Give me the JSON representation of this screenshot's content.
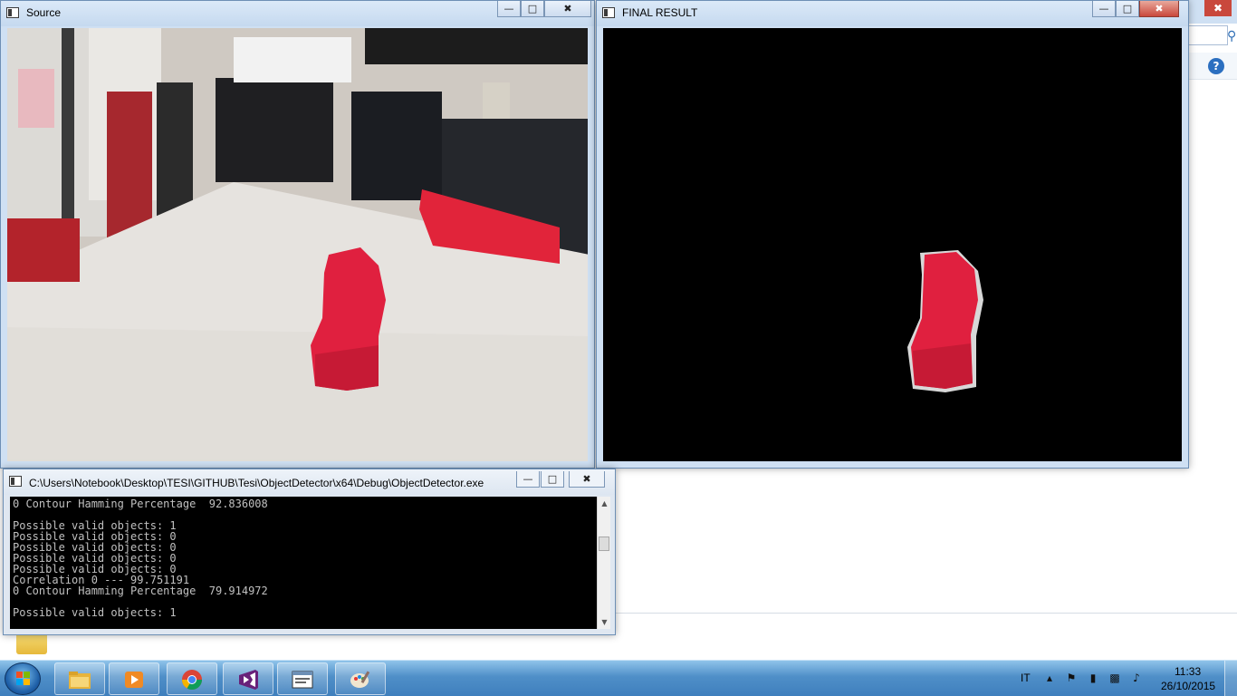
{
  "windows": {
    "source": {
      "title": "Source"
    },
    "final": {
      "title": "FINAL RESULT"
    },
    "console": {
      "title": "C:\\Users\\Notebook\\Desktop\\TESI\\GITHUB\\Tesi\\ObjectDetector\\x64\\Debug\\ObjectDetector.exe",
      "lines": [
        "0 Contour Hamming Percentage  92.836008",
        "",
        "Possible valid objects: 1",
        "Possible valid objects: 0",
        "Possible valid objects: 0",
        "Possible valid objects: 0",
        "Possible valid objects: 0",
        "Correlation 0 --- 99.751191",
        "0 Contour Hamming Percentage  79.914972",
        "",
        "Possible valid objects: 1"
      ]
    }
  },
  "controls": {
    "minimize": "—",
    "maximize": "□",
    "close": "✖"
  },
  "taskbar": {
    "items": [
      {
        "name": "file-explorer",
        "icon": "folder-icon"
      },
      {
        "name": "media-player",
        "icon": "media-player-icon"
      },
      {
        "name": "chrome",
        "icon": "chrome-icon"
      },
      {
        "name": "visual-studio",
        "icon": "visual-studio-icon"
      },
      {
        "name": "object-detector",
        "icon": "console-app-icon"
      },
      {
        "name": "paint",
        "icon": "paint-icon"
      }
    ],
    "language": "IT",
    "time": "11:33",
    "date": "26/10/2015"
  }
}
